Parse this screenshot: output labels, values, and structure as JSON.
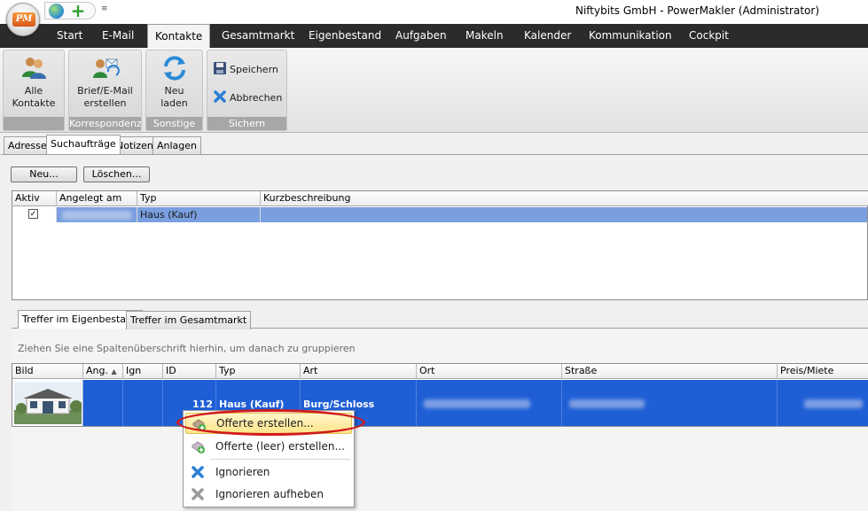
{
  "window": {
    "title": "Niftybits GmbH  - PowerMakler (Administrator)",
    "logo_text": "PM",
    "qa_dropdown": "≡"
  },
  "ribbon": {
    "tabs": [
      "Start",
      "E-Mail",
      "Kontakte",
      "Gesamtmarkt",
      "Eigenbestand",
      "Aufgaben",
      "Makeln",
      "Kalender",
      "Kommunikation",
      "Cockpit"
    ],
    "active_tab": "Kontakte",
    "groups": {
      "kontakte": {
        "label": "",
        "alle_kontakte_line1": "Alle",
        "alle_kontakte_line2": "Kontakte"
      },
      "korrespondenz": {
        "label": "Korrespondenz",
        "brief_line1": "Brief/E-Mail",
        "brief_line2": "erstellen"
      },
      "sonstige": {
        "label": "Sonstige",
        "neu_laden_line1": "Neu",
        "neu_laden_line2": "laden"
      },
      "sichern": {
        "label": "Sichern",
        "speichern": "Speichern",
        "abbrechen": "Abbrechen"
      }
    }
  },
  "detail_tabs": [
    "Adresse",
    "Suchaufträge",
    "Notizen",
    "Anlagen"
  ],
  "suchauftraege": {
    "buttons": {
      "neu": "Neu...",
      "loeschen": "Löschen..."
    },
    "columns": [
      "Aktiv",
      "Angelegt am",
      "Typ",
      "Kurzbeschreibung"
    ],
    "rows": [
      {
        "aktiv": "✓",
        "angelegt_am": "",
        "typ": "Haus (Kauf)",
        "kurzbeschreibung": ""
      }
    ]
  },
  "treffer": {
    "tabs": [
      "Treffer im Eigenbestand",
      "Treffer im Gesamtmarkt"
    ],
    "group_hint": "Ziehen Sie eine Spaltenüberschrift hierhin, um danach zu gruppieren",
    "columns": [
      "Bild",
      "Ang.",
      "Ign",
      "ID",
      "Typ",
      "Art",
      "Ort",
      "Straße",
      "Preis/Miete"
    ],
    "rows": [
      {
        "id": "112",
        "typ": "Haus (Kauf)",
        "art": "Burg/Schloss"
      }
    ]
  },
  "context_menu": {
    "items": [
      "Offerte erstellen...",
      "Offerte (leer) erstellen...",
      "Ignorieren",
      "Ignorieren aufheben"
    ]
  },
  "colors": {
    "ribbon_tabs_bg": "#2b2b2b",
    "row_selected": "#7a9fe0",
    "row_selected_dark": "#1f5fd6",
    "highlight": "#d01c1c"
  }
}
